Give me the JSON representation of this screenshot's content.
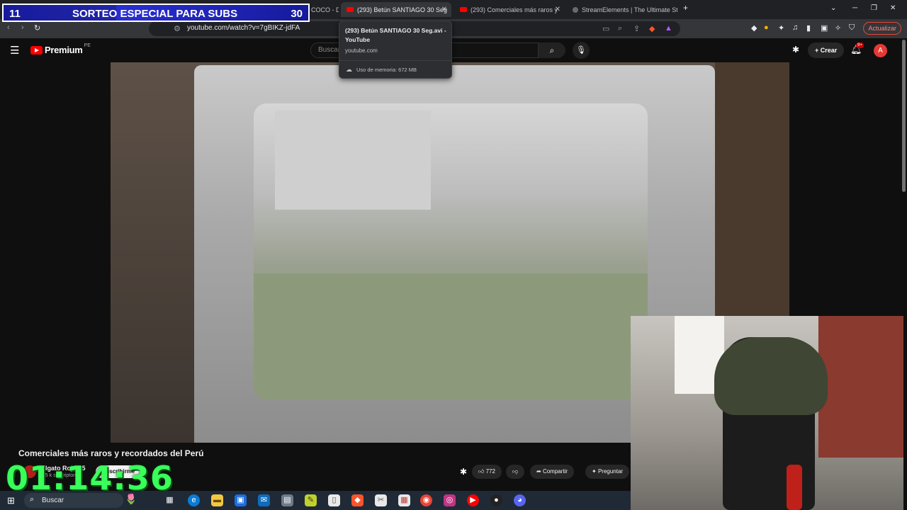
{
  "browser": {
    "tabs": [
      {
        "label": "(293) EL AGUITA DE COCO - DJ JB (",
        "active": false
      },
      {
        "label": "(293) Betún SANTIAGO 30 Seg",
        "active": true
      },
      {
        "label": "(293) Comerciales más raros y",
        "active": false
      },
      {
        "label": "StreamElements | The Ultimate Strea",
        "active": false
      }
    ],
    "new_tab": "+",
    "url": "youtube.com/watch?v=7gBIKZ-jdFA",
    "update_button": "Actualizar"
  },
  "hover_card": {
    "title": "(293) Betún SANTIAGO 30 Seg.avi - YouTube",
    "domain": "youtube.com",
    "memory": "Uso de memoria: 672 MB"
  },
  "youtube": {
    "logo_text": "Premium",
    "logo_country": "PE",
    "search_placeholder": "Buscar",
    "create_label": "Crear",
    "notifications_badge": "9+",
    "avatar_letter": "A"
  },
  "video": {
    "title": "Comerciales más raros y recordados del Perú",
    "channel_name": "Elgato Rojo 85",
    "channel_subs": "6,5 k suscriptores",
    "subscribe_label": "Suscribirme",
    "likes": "772",
    "share_label": "Compartir",
    "ask_label": "Preguntar"
  },
  "overlay": {
    "giveaway_left": "11",
    "giveaway_title": "SORTEO ESPECIAL PARA SUBS",
    "giveaway_right": "30",
    "giveaway_progress": 0.37,
    "timer": "01:14:36"
  },
  "taskbar": {
    "search_label": "Buscar"
  },
  "colors": {
    "timer": "#39ff5a",
    "giveaway_bg": "#1e22c9",
    "youtube_red": "#ff0000"
  }
}
